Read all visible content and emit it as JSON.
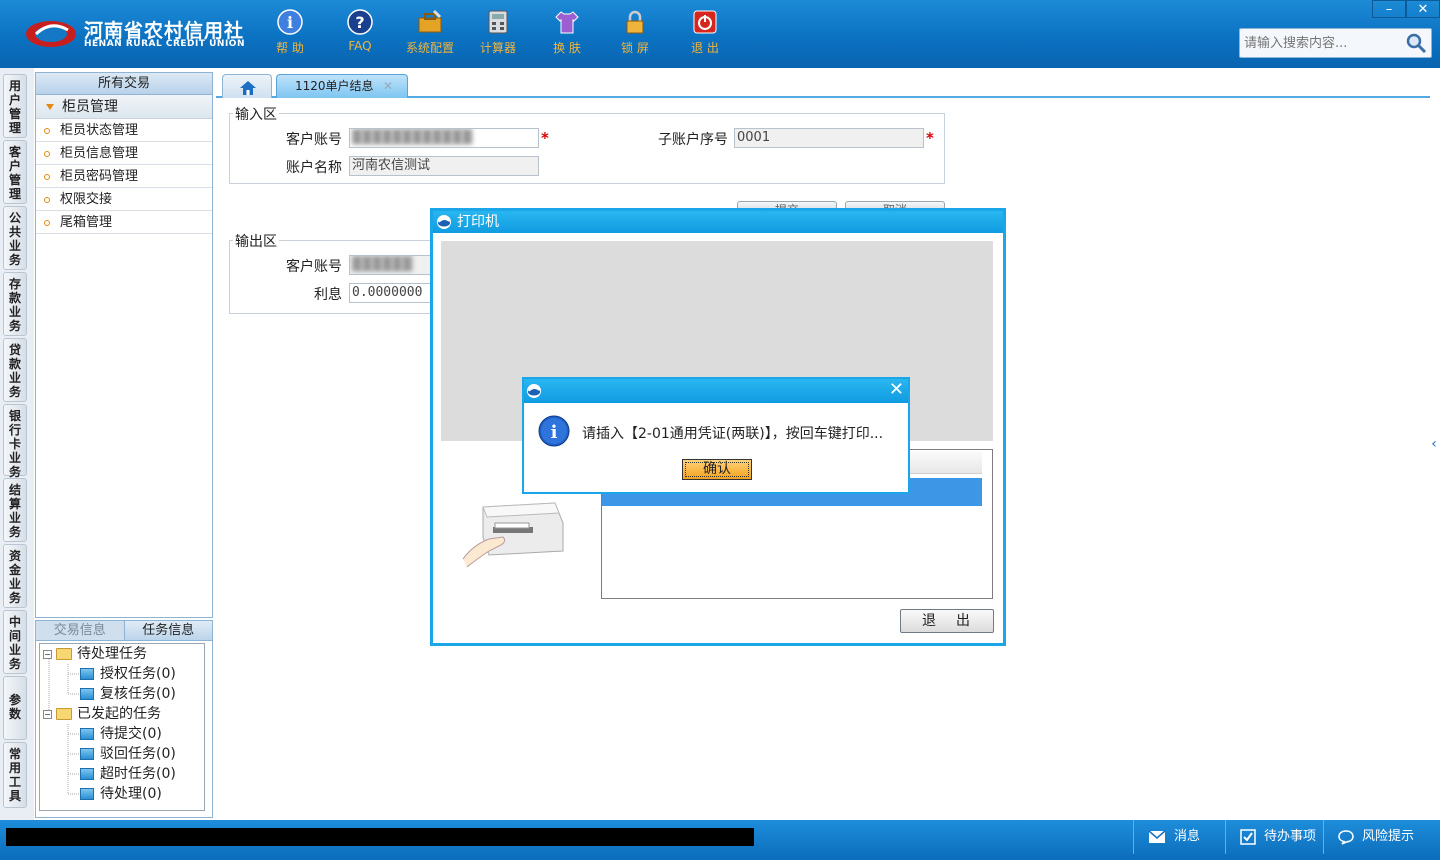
{
  "header": {
    "logo_cn": "河南省农村信用社",
    "logo_en": "HENAN RURAL CREDIT UNION",
    "tools": [
      {
        "label": "帮 助",
        "icon": "info-icon"
      },
      {
        "label": "FAQ",
        "icon": "question-icon"
      },
      {
        "label": "系统配置",
        "icon": "toolbox-icon"
      },
      {
        "label": "计算器",
        "icon": "calculator-icon"
      },
      {
        "label": "换 肤",
        "icon": "shirt-icon"
      },
      {
        "label": "锁 屏",
        "icon": "lock-icon"
      },
      {
        "label": "退 出",
        "icon": "power-icon"
      }
    ],
    "window_min": "–",
    "window_close": "✕",
    "search_placeholder": "请输入搜索内容..."
  },
  "categories": [
    "用户管理",
    "客户管理",
    "公共业务",
    "存款业务",
    "贷款业务",
    "银行卡业务",
    "结算业务",
    "资金业务",
    "中间业务",
    "参数",
    "常用工具"
  ],
  "sidemenu": {
    "title": "所有交易",
    "group": "柜员管理",
    "items": [
      "柜员状态管理",
      "柜员信息管理",
      "柜员密码管理",
      "权限交接",
      "尾箱管理"
    ]
  },
  "taskpanel": {
    "tabs": [
      "交易信息",
      "任务信息"
    ],
    "tree": [
      {
        "label": "待处理任务",
        "level": 0
      },
      {
        "label": "授权任务(0)",
        "level": 1
      },
      {
        "label": "复核任务(0)",
        "level": 1
      },
      {
        "label": "已发起的任务",
        "level": 0
      },
      {
        "label": "待提交(0)",
        "level": 1
      },
      {
        "label": "驳回任务(0)",
        "level": 1
      },
      {
        "label": "超时任务(0)",
        "level": 1
      },
      {
        "label": "待处理(0)",
        "level": 1
      }
    ]
  },
  "tabs": {
    "active": "1120单户结息",
    "close": "✕"
  },
  "form": {
    "input_section": "输入区",
    "account_label": "客户账号",
    "account_value": "████████████",
    "subaccount_label": "子账户序号",
    "subaccount_value": "0001",
    "name_label": "账户名称",
    "name_value": "河南农信测试",
    "required_mark": "*",
    "btn_confirm": "提交",
    "btn_cancel": "取消",
    "output_section": "输出区",
    "out_account_label": "客户账号",
    "out_account_value": "██████",
    "interest_label": "利息",
    "interest_value": "0.0000000"
  },
  "printer_dialog": {
    "title": "打印机",
    "exit": "退出"
  },
  "msgbox": {
    "message": "请插入【2-01通用凭证(两联)】，按回车键打印...",
    "ok": "确认",
    "close": "✕"
  },
  "statusbar": {
    "items": [
      "消息",
      "待办事项",
      "风险提示"
    ]
  },
  "colors": {
    "header_blue": "#0b72c2",
    "dialog_border": "#1aa6e8",
    "tool_label": "#f2b53a",
    "accent_orange": "#e28a12"
  }
}
